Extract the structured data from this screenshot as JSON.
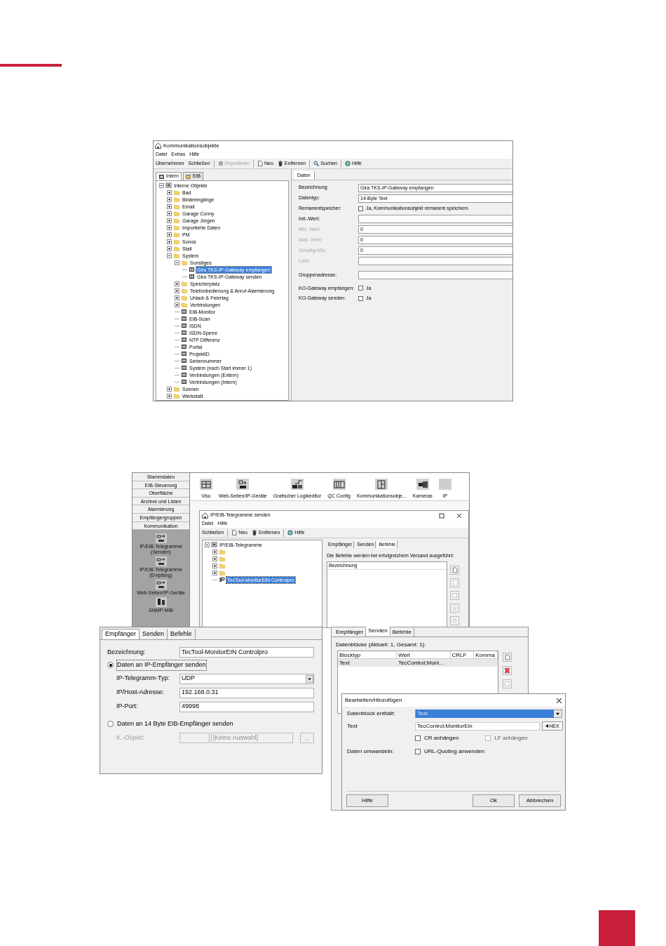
{
  "objects_window": {
    "title": "Kommunikationsobjekte",
    "menu": [
      "Datei",
      "Extras",
      "Hilfe"
    ],
    "toolbar": [
      {
        "label": "Übernehmen",
        "disabled": false
      },
      {
        "label": "Schließen",
        "disabled": false
      },
      {
        "label": "Importieren",
        "disabled": true
      },
      {
        "label": "Neu",
        "disabled": false
      },
      {
        "label": "Entfernen",
        "disabled": false
      },
      {
        "label": "Suchen",
        "disabled": false
      },
      {
        "label": "Hilfe",
        "disabled": false
      }
    ],
    "tabs": [
      {
        "label": "Intern",
        "selected": true
      },
      {
        "label": "EIB",
        "selected": false
      }
    ],
    "tree": [
      {
        "label": "Interne Objekte",
        "kind": "root",
        "expanded": true,
        "selected": false,
        "children": [
          {
            "label": "Bad",
            "kind": "folder",
            "expanded": false,
            "selected": false
          },
          {
            "label": "Binäreingänge",
            "kind": "folder",
            "expanded": false,
            "selected": false
          },
          {
            "label": "Email",
            "kind": "folder",
            "expanded": false,
            "selected": false
          },
          {
            "label": "Garage Conny",
            "kind": "folder",
            "expanded": false,
            "selected": false
          },
          {
            "label": "Garage Jürgen",
            "kind": "folder",
            "expanded": false,
            "selected": false
          },
          {
            "label": "Importierte Daten",
            "kind": "folder",
            "expanded": false,
            "selected": false
          },
          {
            "label": "PM",
            "kind": "folder",
            "expanded": false,
            "selected": false
          },
          {
            "label": "Sonos",
            "kind": "folder",
            "expanded": false,
            "selected": false
          },
          {
            "label": "Stall",
            "kind": "folder",
            "expanded": false,
            "selected": false
          },
          {
            "label": "System",
            "kind": "folder",
            "expanded": true,
            "selected": false,
            "children": [
              {
                "label": "Sonstiges",
                "kind": "folder",
                "expanded": true,
                "selected": false,
                "children": [
                  {
                    "label": "Gira TKS-IP-Gateway empfangen",
                    "kind": "object",
                    "selected": true
                  },
                  {
                    "label": "Gira TKS-IP-Gateway senden",
                    "kind": "object",
                    "selected": false
                  }
                ]
              },
              {
                "label": "Speicherplatz",
                "kind": "folder",
                "expanded": false,
                "selected": false
              },
              {
                "label": "Telefonbedienung & Anruf-Alarmierung",
                "kind": "folder",
                "expanded": false,
                "selected": false
              },
              {
                "label": "Urlaub & Feiertag",
                "kind": "folder",
                "expanded": false,
                "selected": false
              },
              {
                "label": "Verbindungen",
                "kind": "folder",
                "expanded": false,
                "selected": false
              },
              {
                "label": "EIB-Monitor",
                "kind": "object",
                "selected": false
              },
              {
                "label": "EIB-Scan",
                "kind": "object",
                "selected": false
              },
              {
                "label": "ISDN",
                "kind": "object",
                "selected": false
              },
              {
                "label": "ISDN-Sperre",
                "kind": "object",
                "selected": false
              },
              {
                "label": "NTP Differenz",
                "kind": "object",
                "selected": false
              },
              {
                "label": "Portal",
                "kind": "object",
                "selected": false
              },
              {
                "label": "ProjektID",
                "kind": "object",
                "selected": false
              },
              {
                "label": "Seriennummer",
                "kind": "object",
                "selected": false
              },
              {
                "label": "System (nach Start immer 1)",
                "kind": "object",
                "selected": false
              },
              {
                "label": "Verbindungen (Extern)",
                "kind": "object",
                "selected": false
              },
              {
                "label": "Verbindungen (Intern)",
                "kind": "object",
                "selected": false
              }
            ]
          },
          {
            "label": "Szenen",
            "kind": "folder",
            "expanded": false,
            "selected": false
          },
          {
            "label": "Werkstatt",
            "kind": "folder",
            "expanded": false,
            "selected": false
          }
        ]
      }
    ],
    "detail_tabs": [
      {
        "label": "Daten",
        "selected": true
      }
    ],
    "fields": [
      {
        "label": "Bezeichnung:",
        "kind": "text",
        "value": "Gira TKS-IP-Gateway empfangen",
        "disabled": false
      },
      {
        "label": "Datentyp:",
        "kind": "text",
        "value": "14-Byte Text",
        "disabled": false
      },
      {
        "label": "Remanentspeicher:",
        "kind": "checkbox",
        "option": "Ja, Kommunikationsobjekt remanent speichern.",
        "checked": false,
        "disabled": false
      },
      {
        "label": "Init.-Wert:",
        "kind": "text",
        "disabled": false
      },
      {
        "label": "Min. Wert:",
        "kind": "text",
        "value": "0",
        "disabled": true
      },
      {
        "label": "Max. Wert:",
        "kind": "text",
        "value": "0",
        "disabled": true
      },
      {
        "label": "Schaltgröße:",
        "kind": "text",
        "value": "0",
        "disabled": true
      },
      {
        "label": "Liste:",
        "kind": "text",
        "disabled": true
      },
      {
        "label": "Gruppenadresse:",
        "kind": "text",
        "disabled": false
      },
      {
        "label": "KO-Gateway empfangen:",
        "kind": "checkbox",
        "option": "Ja",
        "checked": false,
        "disabled": false
      },
      {
        "label": "KO-Gateway senden:",
        "kind": "checkbox",
        "option": "Ja",
        "checked": false,
        "disabled": false
      }
    ]
  },
  "app_window": {
    "sections": [
      "Stammdaten",
      "EIB-Steuerung",
      "Oberfläche",
      "Archive und Listen",
      "Alarmierung",
      "Empfängergruppen",
      "Kommunikation"
    ],
    "items": [
      "IP/EIB-Telegramme (Senden)",
      "IP/EIB-Telegramme (Empfang)",
      "Web-Seiten/IP-Geräte",
      "SNMP-MIB"
    ],
    "modules": [
      "Visu",
      "Web-Seiten/IP-Geräte",
      "Grafischer Logikeditor",
      "QC Config",
      "Kommunikationsobje...",
      "Kameras",
      "IP"
    ]
  },
  "telegram_window": {
    "title": "IP/EIB-Telegramme senden",
    "menu": [
      "Datei",
      "Hilfe"
    ],
    "toolbar": [
      {
        "label": "Schließen"
      },
      {
        "label": "Neu"
      },
      {
        "label": "Entfernen"
      },
      {
        "label": "Hilfe"
      }
    ],
    "tree": [
      {
        "label": "IP/EIB-Telegramme",
        "kind": "root",
        "expanded": true,
        "selected": false,
        "children": [
          {
            "kind": "folder",
            "expanded": false
          },
          {
            "kind": "folder",
            "expanded": false
          },
          {
            "kind": "folder",
            "expanded": false
          },
          {
            "kind": "folder",
            "expanded": false
          },
          {
            "label": "TecTool-MonitorEIN Controlpro",
            "kind": "telegram",
            "selected": true
          }
        ]
      }
    ],
    "tabs": [
      {
        "label": "Empfänger",
        "selected": false
      },
      {
        "label": "Senden",
        "selected": false
      },
      {
        "label": "Befehle",
        "selected": true
      }
    ],
    "note": "Die Befehle werden bei erfolgreichem Versand ausgeführt:",
    "column": "Bezeichnung"
  },
  "receiver_panel": {
    "tabs": [
      {
        "label": "Empfänger",
        "selected": true
      },
      {
        "label": "Senden",
        "selected": false
      },
      {
        "label": "Befehle",
        "selected": false
      }
    ],
    "name_label": "Bezeichnung:",
    "name_value": "TecTool-MonitorEIN Controlpro",
    "options": [
      {
        "label": "Daten an IP-Empfänger senden",
        "selected": true
      },
      {
        "label": "Daten an 14 Byte EIB-Empfänger senden",
        "selected": false
      }
    ],
    "ip_fields": [
      {
        "label": "IP-Telegramm-Typ:",
        "kind": "select",
        "value": "UDP"
      },
      {
        "label": "IP/Host-Adresse:",
        "kind": "text",
        "value": "192.168.0.31"
      },
      {
        "label": "IP-Port:",
        "kind": "text",
        "value": "49998"
      }
    ],
    "object_field": {
      "label": "K.-Objekt:",
      "value": "[Keine Auswahl]",
      "button": "...",
      "disabled": true
    }
  },
  "send_panel": {
    "tabs": [
      {
        "label": "Empfänger",
        "selected": false
      },
      {
        "label": "Senden",
        "selected": true
      },
      {
        "label": "Befehle",
        "selected": false
      }
    ],
    "caption": "Datenblöcke (Aktuell: 1, Gesamt: 1):",
    "columns": [
      "Blocktyp",
      "Wert",
      "CRLF",
      "Komma"
    ],
    "rows": [
      {
        "cells": [
          "Text",
          "TecControl;Moni..."
        ],
        "selected": true
      }
    ]
  },
  "edit_dialog": {
    "title": "Bearbeiten/Hinzufügen",
    "fields": [
      {
        "label": "Datenblock enthält:",
        "kind": "select",
        "value": "Text",
        "highlighted": true
      },
      {
        "label": "Text",
        "kind": "text",
        "value": "TecControl;MonitorEin",
        "button": "HEX",
        "highlighted": false
      }
    ],
    "checks": [
      {
        "label": "CR anhängen",
        "checked": false,
        "disabled": false
      },
      {
        "label": "LF anhängen",
        "checked": false,
        "disabled": true
      }
    ],
    "convert_label": "Daten umwandeln:",
    "convert": {
      "label": "URL-Quoting anwenden",
      "checked": false
    },
    "buttons": [
      "Hilfe",
      "Ok",
      "Abbrechen"
    ]
  }
}
